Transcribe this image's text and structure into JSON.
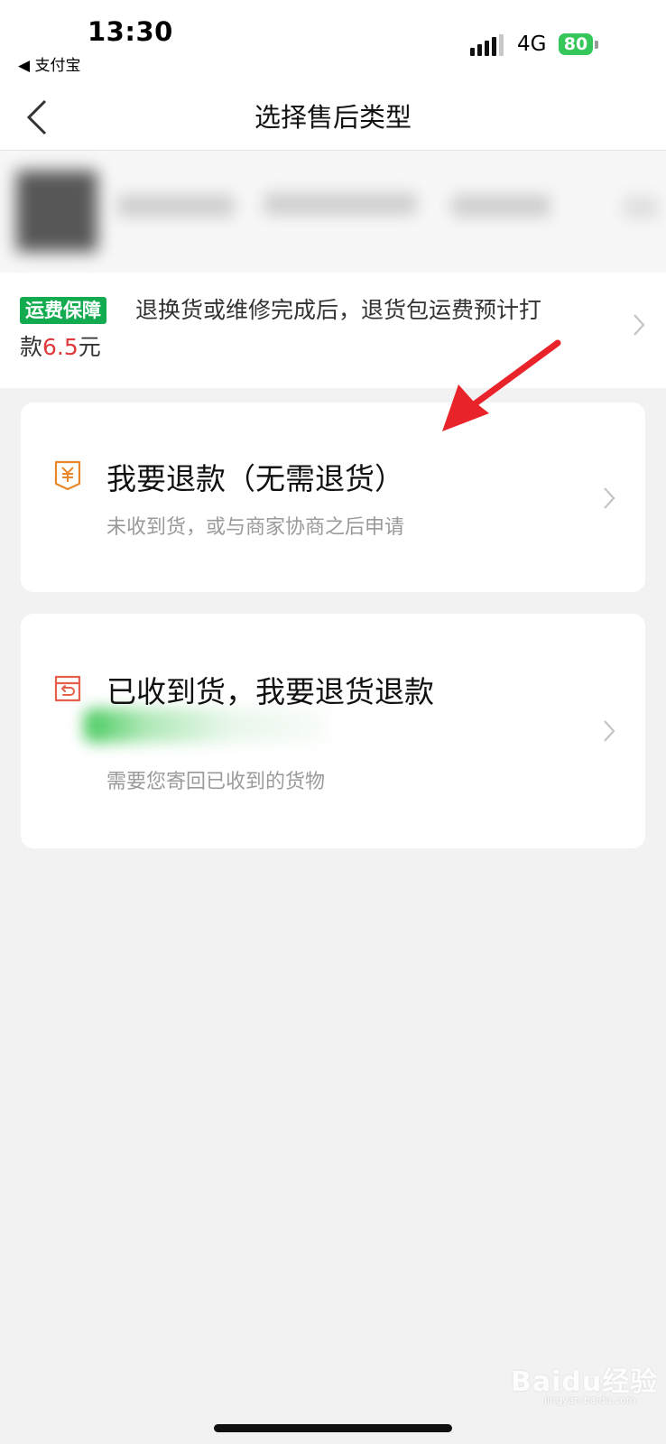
{
  "status_bar": {
    "time": "13:30",
    "back_app": "◀ 支付宝",
    "network": "4G",
    "battery": "80"
  },
  "nav": {
    "title": "选择售后类型"
  },
  "shipping": {
    "badge": "运费保障",
    "text_line1": "退换货或维修完成后，退货包运费预计打",
    "text_line2_prefix": "款",
    "amount": "6.5",
    "text_line2_suffix": "元"
  },
  "options": [
    {
      "title": "我要退款（无需退货）",
      "subtitle": "未收到货，或与商家协商之后申请"
    },
    {
      "title": "已收到货，我要退货退款",
      "subtitle": "需要您寄回已收到的货物"
    }
  ],
  "watermark": {
    "logo": "Baidu经验",
    "url": "jingyan.baidu.com"
  },
  "colors": {
    "badge_green": "#12ab4f",
    "price_red": "#e03a3a",
    "icon_orange": "#e8872a",
    "icon_red": "#e5604a",
    "annotation_red": "#e8232a"
  }
}
